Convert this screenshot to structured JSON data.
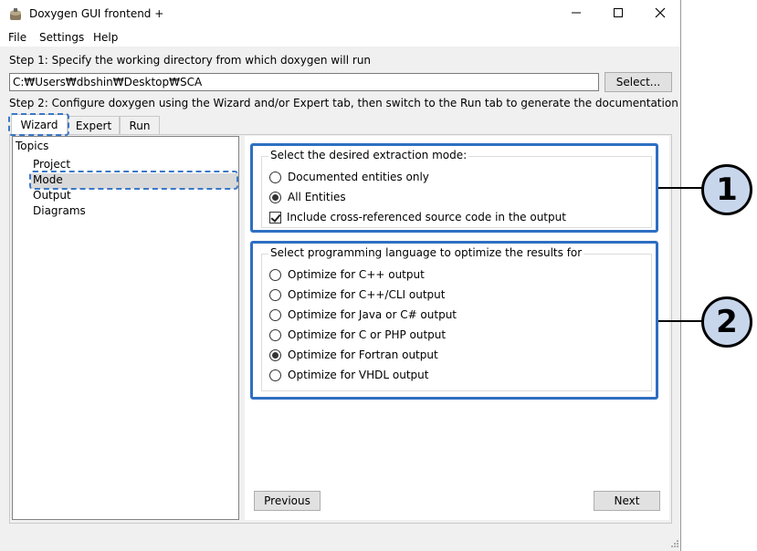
{
  "window": {
    "title": "Doxygen GUI frontend +",
    "minimize_icon": "minimize-icon",
    "maximize_icon": "maximize-icon",
    "close_icon": "close-icon"
  },
  "menu": [
    "File",
    "Settings",
    "Help"
  ],
  "step1": {
    "label": "Step 1: Specify the working directory from which doxygen will run",
    "path_value": "C:₩Users₩dbshin₩Desktop₩SCA",
    "select_button": "Select..."
  },
  "step2": {
    "label": "Step 2: Configure doxygen using the Wizard and/or Expert tab, then switch to the Run tab to generate the documentation"
  },
  "tabs": [
    {
      "label": "Wizard",
      "active": true
    },
    {
      "label": "Expert",
      "active": false
    },
    {
      "label": "Run",
      "active": false
    }
  ],
  "topics": {
    "header": "Topics",
    "items": [
      "Project",
      "Mode",
      "Output",
      "Diagrams"
    ],
    "selected": "Mode"
  },
  "extraction": {
    "title": "Select the desired extraction mode:",
    "options": [
      {
        "label": "Documented entities only",
        "selected": false
      },
      {
        "label": "All Entities",
        "selected": true
      }
    ],
    "checkbox": {
      "label": "Include cross-referenced source code in the output",
      "checked": true
    }
  },
  "language": {
    "title": "Select programming language to optimize the results for",
    "options": [
      {
        "label": "Optimize for C++ output",
        "selected": false
      },
      {
        "label": "Optimize for C++/CLI output",
        "selected": false
      },
      {
        "label": "Optimize for Java or C# output",
        "selected": false
      },
      {
        "label": "Optimize for C or PHP output",
        "selected": false
      },
      {
        "label": "Optimize for Fortran output",
        "selected": true
      },
      {
        "label": "Optimize for VHDL output",
        "selected": false
      }
    ]
  },
  "nav": {
    "previous": "Previous",
    "next": "Next"
  },
  "callouts": [
    "1",
    "2"
  ],
  "colors": {
    "highlight": "#2e6fc2",
    "callout_fill": "#c8d6ec"
  }
}
